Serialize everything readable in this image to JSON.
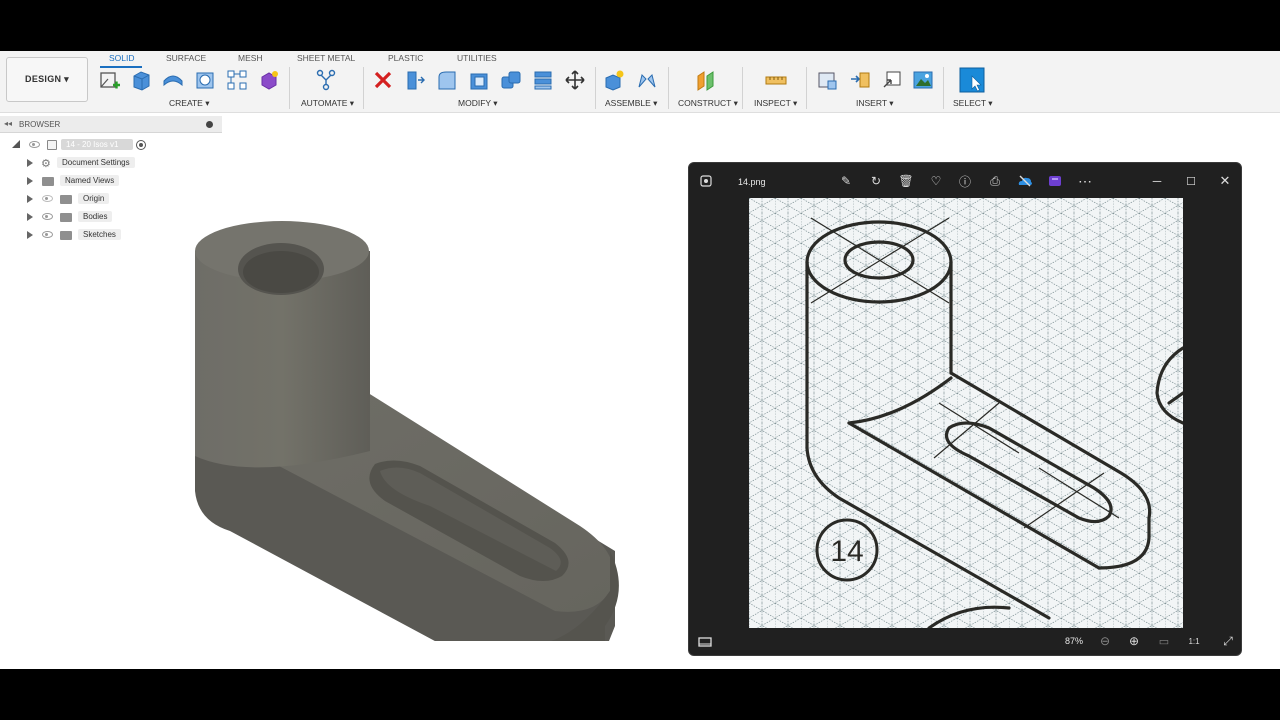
{
  "toolbar": {
    "design_label": "DESIGN ▾",
    "tabs": [
      "SOLID",
      "SURFACE",
      "MESH",
      "SHEET METAL",
      "PLASTIC",
      "UTILITIES"
    ],
    "groups": {
      "create": "CREATE ▾",
      "automate": "AUTOMATE ▾",
      "modify": "MODIFY ▾",
      "assemble": "ASSEMBLE ▾",
      "construct": "CONSTRUCT ▾",
      "inspect": "INSPECT ▾",
      "insert": "INSERT ▾",
      "select": "SELECT ▾"
    }
  },
  "browser": {
    "header": "BROWSER",
    "document": "14 - 20 Isos v1",
    "items": [
      "Document Settings",
      "Named Views",
      "Origin",
      "Bodies",
      "Sketches"
    ]
  },
  "photos": {
    "filename": "14.png",
    "zoom": "87%",
    "drawing_label": "14",
    "toolbar_icons": [
      "edit-icon",
      "rotate-icon",
      "delete-icon",
      "favorite-icon",
      "info-icon",
      "print-icon",
      "onedrive-icon",
      "clipchamp-icon",
      "more-icon"
    ],
    "window_controls": [
      "minimize-icon",
      "maximize-icon",
      "close-icon"
    ]
  },
  "colors": {
    "accent": "#1a6fc0",
    "model_face": "#6b6a64",
    "model_dark": "#4a4944",
    "photos_bg": "#202020"
  }
}
